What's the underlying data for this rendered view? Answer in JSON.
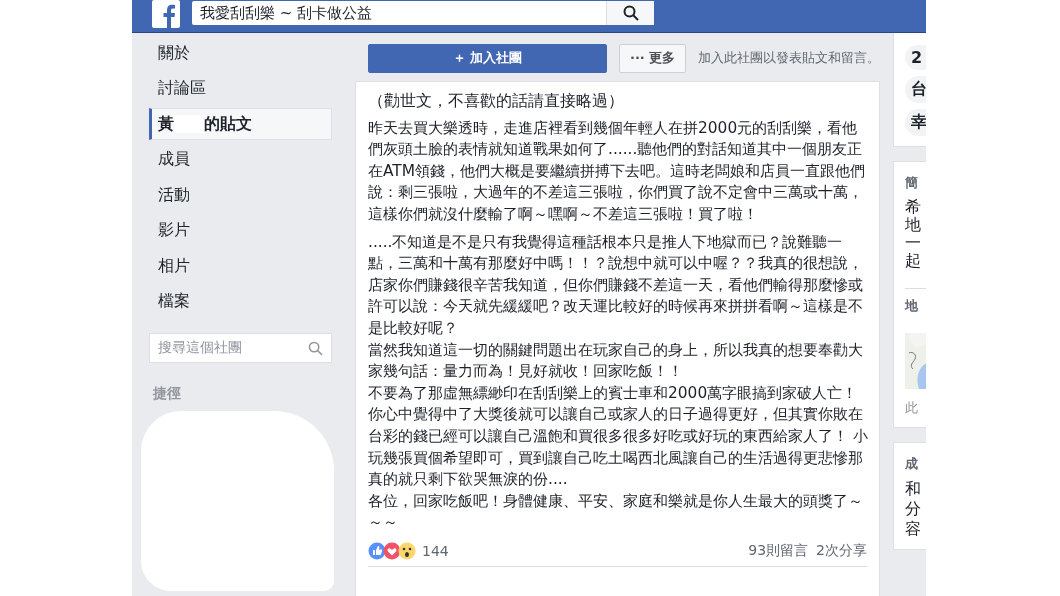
{
  "top_bar": {
    "search": {
      "value": "我愛刮刮樂 ~ 刮卡做公益"
    }
  },
  "sidebar": {
    "items": [
      {
        "label": "關於",
        "selected": false
      },
      {
        "label": "討論區",
        "selected": false
      },
      {
        "label": "黃",
        "label_after_redaction": "的貼文",
        "selected": true
      },
      {
        "label": "成員",
        "selected": false
      },
      {
        "label": "活動",
        "selected": false
      },
      {
        "label": "影片",
        "selected": false
      },
      {
        "label": "相片",
        "selected": false
      },
      {
        "label": "檔案",
        "selected": false
      }
    ],
    "search": {
      "placeholder": "搜尋這個社團"
    },
    "shortcuts_heading": "捷徑"
  },
  "join_bar": {
    "join_icon": "＋",
    "join_button": "加入社團",
    "more_icon": "···",
    "more_button": "更多",
    "hint": "加入此社團以發表貼文和留言。"
  },
  "post": {
    "paragraphs": [
      {
        "sentences": [
          "（勸世文，不喜歡的話請直接略過）"
        ]
      },
      {
        "sentences": [
          "昨天去買大樂透時，走進店裡看到幾個年輕人在拼2000元的刮刮樂，看他們灰頭土臉的表情就知道戰果如何了......聽他們的對話知道其中一個朋友正在ATM領錢，他們大概是要繼續拼搏下去吧。這時老闆娘和店員一直跟他們說：剩三張啦，大過年的不差這三張啦，你們買了說不定會中三萬或十萬，這樣你們就沒什麼輸了啊～嘿啊～不差這三張啦！買了啦！"
        ]
      },
      {
        "sentences": [
          ".....不知道是不是只有我覺得這種話根本只是推人下地獄而已？說難聽一點，三萬和十萬有那麼好中嗎！！？說想中就可以中喔？？我真的很想說，店家你們賺錢很辛苦我知道，但你們賺錢不差這一天，看他們輸得那麼慘或許可以說：今天就先緩緩吧？改天運比較好的時候再來拼拼看啊～這樣是不是比較好呢？",
          "當然我知道這一切的關鍵問題出在玩家自己的身上，所以我真的想要奉勸大家幾句話：量力而為！見好就收！回家吃飯！！",
          "不要為了那虛無縹緲印在刮刮樂上的賓士車和2000萬字眼搞到家破人亡！你心中覺得中了大獎後就可以讓自己或家人的日子過得更好，但其實你敗在台彩的錢已經可以讓自己溫飽和買很多很多好吃或好玩的東西給家人了！ 小玩幾張買個希望即可，買到讓自己吃土喝西北風讓自己的生活過得更悲慘那真的就只剩下欲哭無淚的份....",
          "各位，回家吃飯吧！身體健康、平安、家庭和樂就是你人生最大的頭獎了～～～"
        ]
      }
    ],
    "reactions": {
      "count": "144"
    },
    "comments": "93則留言",
    "shares": "2次分享"
  },
  "right_column": {
    "tags": [
      "2",
      "台",
      "幸"
    ],
    "about_card": {
      "heading": "簡",
      "lines": [
        "希",
        "地",
        "一",
        "起"
      ],
      "location_heading": "地",
      "map_caption": "此"
    },
    "created_card": {
      "heading": "成",
      "lines": [
        "和",
        "分",
        "容"
      ]
    }
  }
}
